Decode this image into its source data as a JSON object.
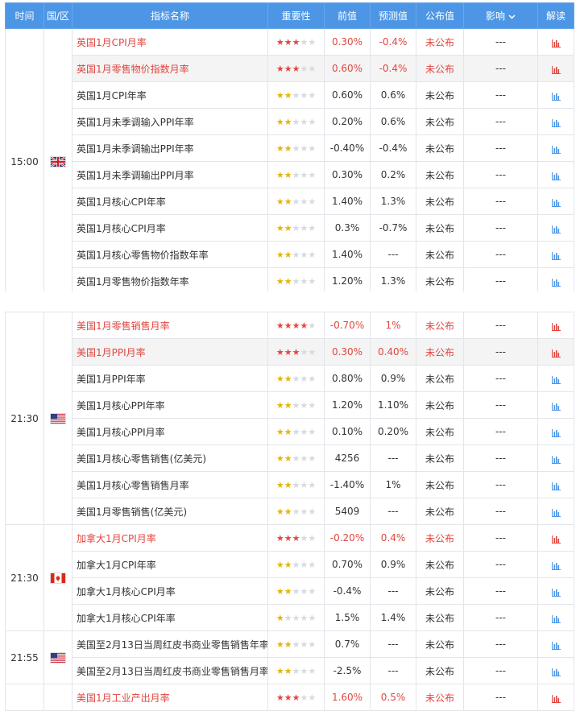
{
  "header": {
    "time": "时间",
    "region": "国/区",
    "name": "指标名称",
    "importance": "重要性",
    "previous": "前值",
    "forecast": "预测值",
    "actual": "公布值",
    "impact": "影响",
    "interpret": "解读"
  },
  "icons": {
    "sort": "chevron-down-icon",
    "chart": "bar-chart-icon"
  },
  "colors": {
    "header_bg": "#4d96e6",
    "highlight_red": "#e1463f",
    "star_yellow": "#e8b400",
    "chart_blue": "#4d96e6"
  },
  "groups_top": [
    {
      "time": "15:00",
      "flag": "uk",
      "rows": [
        {
          "name": "英国1月CPI月率",
          "stars": 3,
          "prev": "0.30%",
          "fc": "-0.4%",
          "act": "未公布",
          "impact": "---",
          "hi": true
        },
        {
          "name": "英国1月零售物价指数月率",
          "stars": 3,
          "prev": "0.60%",
          "fc": "-0.4%",
          "act": "未公布",
          "impact": "---",
          "hi": true
        },
        {
          "name": "英国1月CPI年率",
          "stars": 2,
          "prev": "0.60%",
          "fc": "0.6%",
          "act": "未公布",
          "impact": "---",
          "hi": false
        },
        {
          "name": "英国1月未季调输入PPI年率",
          "stars": 2,
          "prev": "0.20%",
          "fc": "0.6%",
          "act": "未公布",
          "impact": "---",
          "hi": false
        },
        {
          "name": "英国1月未季调输出PPI年率",
          "stars": 2,
          "prev": "-0.40%",
          "fc": "-0.4%",
          "act": "未公布",
          "impact": "---",
          "hi": false
        },
        {
          "name": "英国1月未季调输出PPI月率",
          "stars": 2,
          "prev": "0.30%",
          "fc": "0.2%",
          "act": "未公布",
          "impact": "---",
          "hi": false
        },
        {
          "name": "英国1月核心CPI年率",
          "stars": 2,
          "prev": "1.40%",
          "fc": "1.3%",
          "act": "未公布",
          "impact": "---",
          "hi": false
        },
        {
          "name": "英国1月核心CPI月率",
          "stars": 2,
          "prev": "0.3%",
          "fc": "-0.7%",
          "act": "未公布",
          "impact": "---",
          "hi": false
        },
        {
          "name": "英国1月核心零售物价指数年率",
          "stars": 2,
          "prev": "1.40%",
          "fc": "---",
          "act": "未公布",
          "impact": "---",
          "hi": false
        },
        {
          "name": "英国1月零售物价指数年率",
          "stars": 2,
          "prev": "1.20%",
          "fc": "1.3%",
          "act": "未公布",
          "impact": "---",
          "hi": false
        }
      ]
    }
  ],
  "groups_bottom": [
    {
      "time": "21:30",
      "flag": "us",
      "rows": [
        {
          "name": "美国1月零售销售月率",
          "stars": 4,
          "prev": "-0.70%",
          "fc": "1%",
          "act": "未公布",
          "impact": "---",
          "hi": true
        },
        {
          "name": "美国1月PPI月率",
          "stars": 3,
          "prev": "0.30%",
          "fc": "0.40%",
          "act": "未公布",
          "impact": "---",
          "hi": true
        },
        {
          "name": "美国1月PPI年率",
          "stars": 2,
          "prev": "0.80%",
          "fc": "0.9%",
          "act": "未公布",
          "impact": "---",
          "hi": false
        },
        {
          "name": "美国1月核心PPI年率",
          "stars": 2,
          "prev": "1.20%",
          "fc": "1.10%",
          "act": "未公布",
          "impact": "---",
          "hi": false
        },
        {
          "name": "美国1月核心PPI月率",
          "stars": 2,
          "prev": "0.10%",
          "fc": "0.20%",
          "act": "未公布",
          "impact": "---",
          "hi": false
        },
        {
          "name": "美国1月核心零售销售(亿美元)",
          "stars": 2,
          "prev": "4256",
          "fc": "---",
          "act": "未公布",
          "impact": "---",
          "hi": false
        },
        {
          "name": "美国1月核心零售销售月率",
          "stars": 2,
          "prev": "-1.40%",
          "fc": "1%",
          "act": "未公布",
          "impact": "---",
          "hi": false
        },
        {
          "name": "美国1月零售销售(亿美元)",
          "stars": 2,
          "prev": "5409",
          "fc": "---",
          "act": "未公布",
          "impact": "---",
          "hi": false
        }
      ]
    },
    {
      "time": "21:30",
      "flag": "ca",
      "rows": [
        {
          "name": "加拿大1月CPI月率",
          "stars": 3,
          "prev": "-0.20%",
          "fc": "0.4%",
          "act": "未公布",
          "impact": "---",
          "hi": true
        },
        {
          "name": "加拿大1月CPI年率",
          "stars": 2,
          "prev": "0.70%",
          "fc": "0.9%",
          "act": "未公布",
          "impact": "---",
          "hi": false
        },
        {
          "name": "加拿大1月核心CPI月率",
          "stars": 2,
          "prev": "-0.4%",
          "fc": "---",
          "act": "未公布",
          "impact": "---",
          "hi": false
        },
        {
          "name": "加拿大1月核心CPI年率",
          "stars": 1,
          "prev": "1.5%",
          "fc": "1.4%",
          "act": "未公布",
          "impact": "---",
          "hi": false
        }
      ]
    },
    {
      "time": "21:55",
      "flag": "us",
      "rows": [
        {
          "name": "美国至2月13日当周红皮书商业零售销售年率",
          "stars": 2,
          "prev": "0.7%",
          "fc": "---",
          "act": "未公布",
          "impact": "---",
          "hi": false
        },
        {
          "name": "美国至2月13日当周红皮书商业零售销售月率",
          "stars": 2,
          "prev": "-2.5%",
          "fc": "---",
          "act": "未公布",
          "impact": "---",
          "hi": false
        }
      ]
    },
    {
      "time": "",
      "flag": "",
      "rows": [
        {
          "name": "美国1月工业产出月率",
          "stars": 3,
          "prev": "1.60%",
          "fc": "0.5%",
          "act": "未公布",
          "impact": "---",
          "hi": true
        }
      ]
    }
  ]
}
